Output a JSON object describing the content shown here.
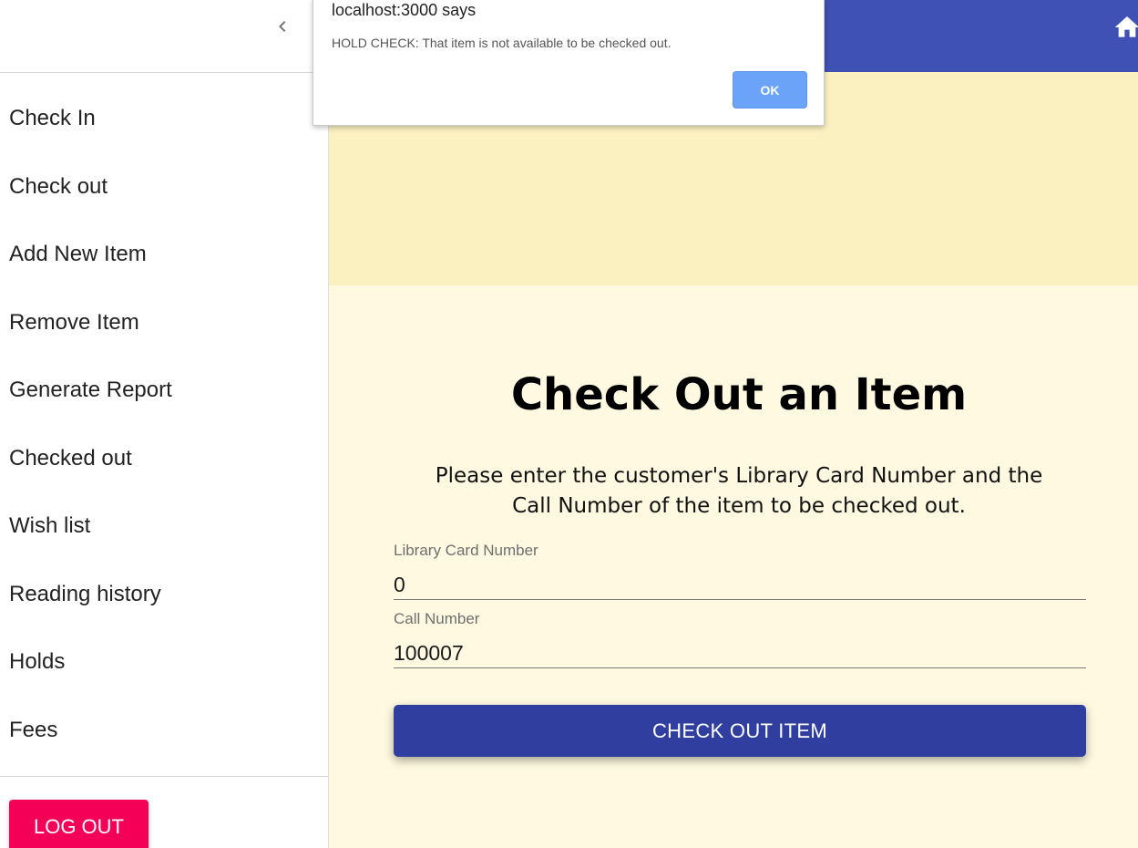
{
  "dialog": {
    "title": "localhost:3000 says",
    "message": "HOLD CHECK: That item is not available to be checked out.",
    "ok_label": "OK"
  },
  "appbar": {
    "color": "#3f51b5",
    "home_icon": "home-icon"
  },
  "drawer": {
    "collapse_icon": "chevron-left-icon",
    "items": [
      {
        "label": "Check In"
      },
      {
        "label": "Check out"
      },
      {
        "label": "Add New Item"
      },
      {
        "label": "Remove Item"
      },
      {
        "label": "Generate Report"
      },
      {
        "label": "Checked out"
      },
      {
        "label": "Wish list"
      },
      {
        "label": "Reading history"
      },
      {
        "label": "Holds"
      },
      {
        "label": "Fees"
      }
    ],
    "logout_label": "LOG OUT",
    "logout_color": "#f50057"
  },
  "main": {
    "title": "Check Out an Item",
    "instructions": "Please enter the customer's Library Card Number and the Call Number of the item to be checked out.",
    "card_field": {
      "label": "Library Card Number",
      "value": "0"
    },
    "call_field": {
      "label": "Call Number",
      "value": "100007"
    },
    "submit_label": "CHECK OUT ITEM",
    "submit_color": "#303f9f",
    "banner_color": "#fbf0c0",
    "background_color": "#fef9e0"
  }
}
